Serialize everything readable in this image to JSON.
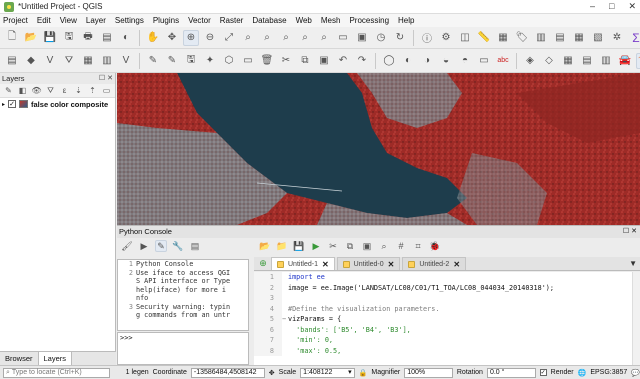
{
  "window": {
    "title": "*Untitled Project - QGIS",
    "minimize": "–",
    "maximize": "□",
    "close": "✕"
  },
  "menu": [
    "Project",
    "Edit",
    "View",
    "Layer",
    "Settings",
    "Plugins",
    "Vector",
    "Raster",
    "Database",
    "Web",
    "Mesh",
    "Processing",
    "Help"
  ],
  "layers_panel": {
    "title": "Layers",
    "controls": "☐ ✕",
    "layer": {
      "name": "false color composite",
      "checked": true
    }
  },
  "bottom_tabs": [
    "Browser",
    "Layers"
  ],
  "console": {
    "title": "Python Console",
    "controls": "☐ ✕",
    "history": [
      {
        "n": "1",
        "text": "Python Console"
      },
      {
        "n": "2",
        "text": "Use iface to access QGI"
      },
      {
        "n": "",
        "text": "S API interface or Type"
      },
      {
        "n": "",
        "text": " help(iface) for more i"
      },
      {
        "n": "",
        "text": "nfo"
      },
      {
        "n": "3",
        "text": "Security warning: typin"
      },
      {
        "n": "",
        "text": "g commands from an untr"
      }
    ],
    "prompt": ">>>",
    "tabs": [
      {
        "label": "Untitled-1",
        "close": "✕",
        "active": true
      },
      {
        "label": "Untitled-0",
        "close": "✕",
        "active": false
      },
      {
        "label": "Untitled-2",
        "close": "✕",
        "active": false
      }
    ],
    "code_lines": [
      {
        "n": "1",
        "fold": "",
        "code": "import ee"
      },
      {
        "n": "2",
        "fold": "",
        "code": "image = ee.Image('LANDSAT/LC08/C01/T1_TOA/LC08_044034_20140318');"
      },
      {
        "n": "3",
        "fold": "",
        "code": ""
      },
      {
        "n": "4",
        "fold": "",
        "code": "#Define the visualization parameters."
      },
      {
        "n": "5",
        "fold": "−",
        "code": "vizParams = {"
      },
      {
        "n": "6",
        "fold": "",
        "code": "  'bands': ['B5', 'B4', 'B3'],"
      },
      {
        "n": "7",
        "fold": "",
        "code": "  'min': 0,"
      },
      {
        "n": "8",
        "fold": "",
        "code": "  'max': 0.5,"
      }
    ]
  },
  "status": {
    "locate_placeholder": "Type to locate (Ctrl+K)",
    "legend": "1 legen",
    "coordinate_label": "Coordinate",
    "coordinate": "-13586484,4508142",
    "scale_label": "Scale",
    "scale": "1:408122",
    "magnifier_label": "Magnifier",
    "magnifier": "100%",
    "rotation_label": "Rotation",
    "rotation": "0.0 °",
    "render_label": "Render",
    "crs": "EPSG:3857"
  },
  "colors": {
    "vegetation": "#b8322c",
    "water": "#1d3a4a",
    "urban": "#8a8f93"
  }
}
